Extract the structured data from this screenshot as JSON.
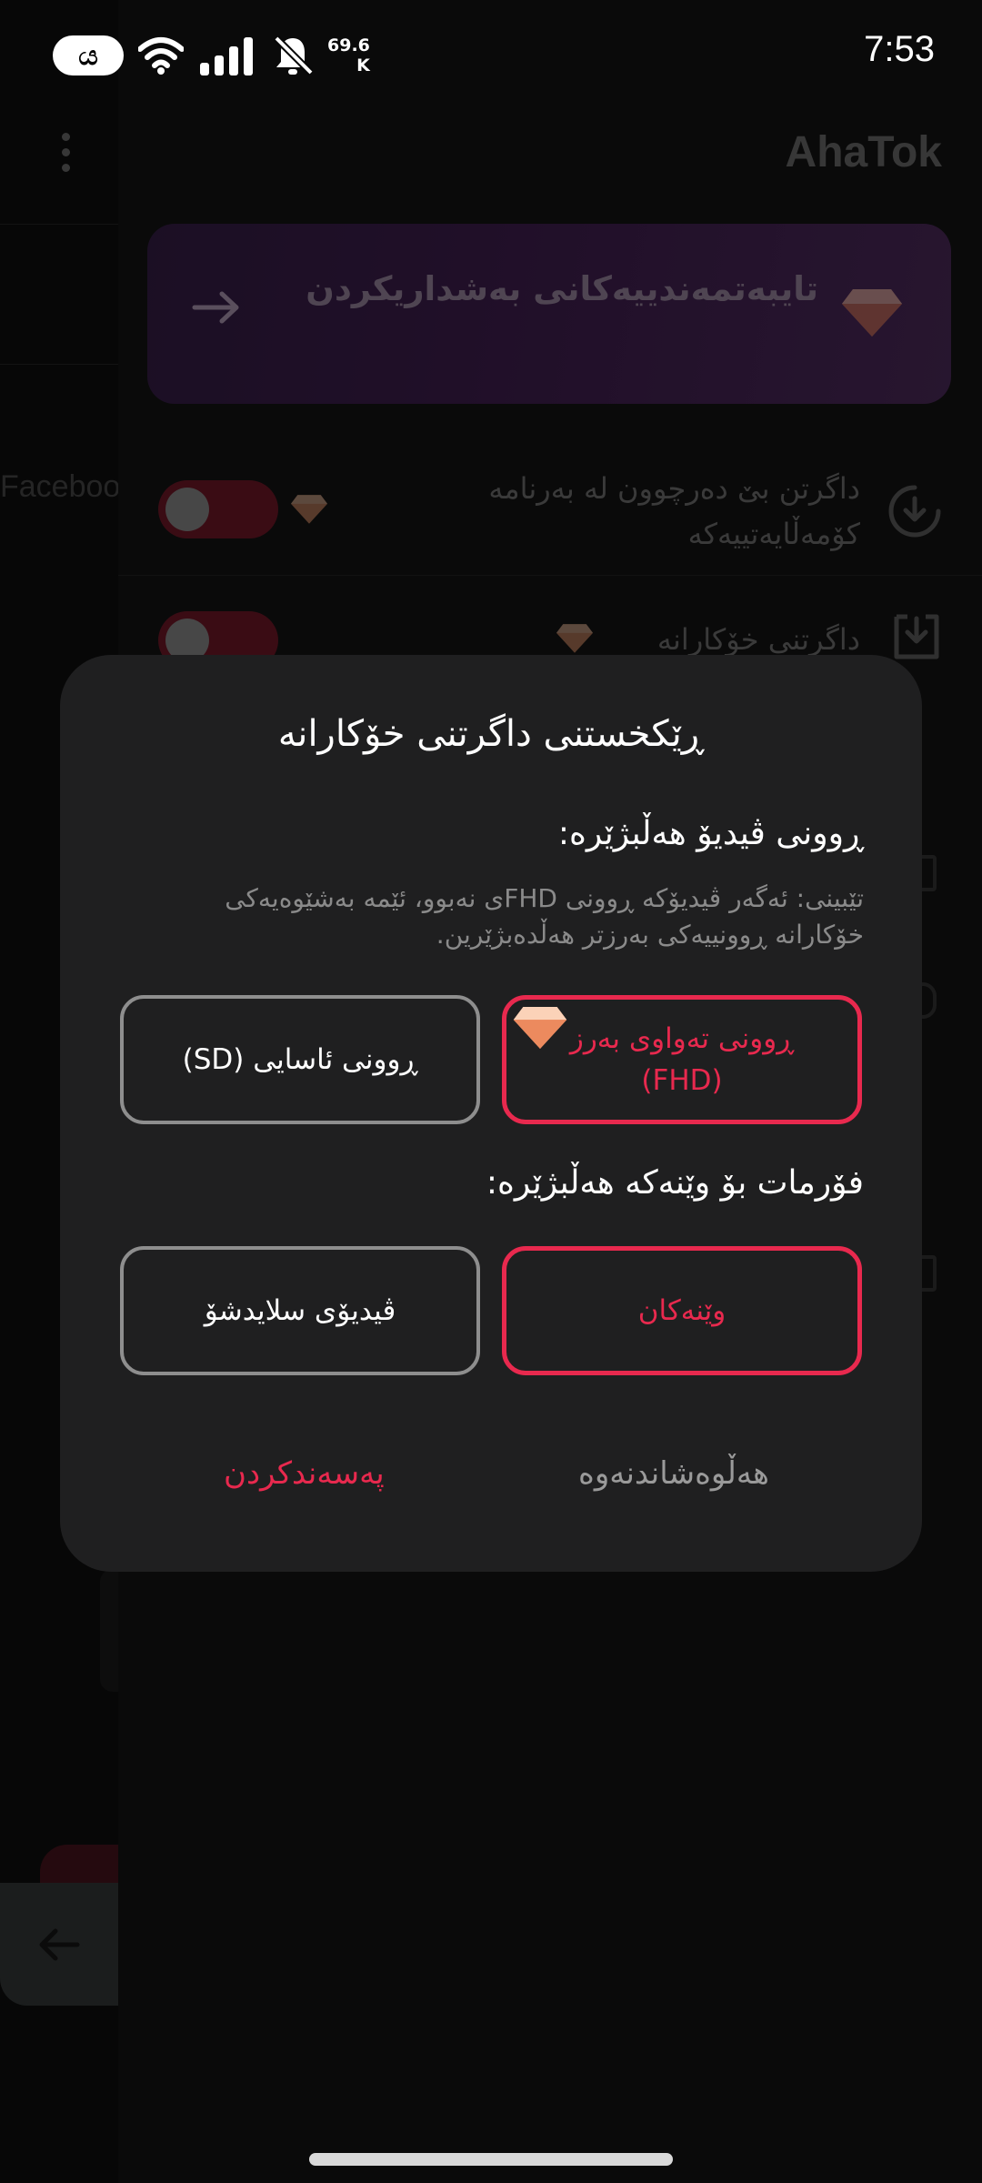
{
  "status_bar": {
    "pill_text": "ය",
    "network_speed_value": "69.6",
    "network_speed_unit": "K",
    "time": "7:53"
  },
  "background": {
    "side_text": "Faceboo",
    "app_title": "AhaTok",
    "premium_banner": {
      "label": "تایبەتمەندییەکانی بەشداریکردن"
    },
    "settings": [
      {
        "label_line1": "داگرتن بێ دەرچوون لە بەرنامە",
        "label_line2": "کۆمەڵایەتییەکە",
        "toggle_on": false,
        "premium": true
      },
      {
        "label_line1": "داگرتنی خۆکارانە",
        "toggle_on": false,
        "premium": true
      }
    ]
  },
  "dialog": {
    "title": "ڕێکخستنی داگرتنی خۆکارانە",
    "quality_heading": "ڕوونی ڤیدیۆ هەڵبژێرە:",
    "quality_note": "تێبینی: ئەگەر ڤیدیۆکە ڕوونی FHDی نەبوو، ئێمە بەشێوەیەکی خۆکارانە ڕوونییەکی بەرزتر هەڵدەبژێرین.",
    "quality_options": [
      {
        "label_line1": "ڕوونی تەواوی بەرز",
        "label_line2": "(FHD)",
        "selected": true,
        "premium": true
      },
      {
        "label_line1": "ڕوونی ئاسایی (SD)",
        "selected": false
      }
    ],
    "format_heading": "فۆرمات بۆ وێنەکە هەڵبژێرە:",
    "format_options": [
      {
        "label": "وێنەکان",
        "selected": true
      },
      {
        "label": "ڤیدیۆی سلایدشۆ",
        "selected": false
      }
    ],
    "confirm_label": "پەسەندکردن",
    "cancel_label": "هەڵوەشاندنەوە"
  },
  "colors": {
    "accent": "#e8294e",
    "dialog_bg": "#1f1f20",
    "premium_gem": "#f2a27c"
  },
  "icons": [
    "wifi-icon",
    "signal-icon",
    "bell-off-icon",
    "arrow-right-icon",
    "diamond-icon",
    "download-circle-icon",
    "download-tray-icon",
    "back-arrow-icon"
  ]
}
